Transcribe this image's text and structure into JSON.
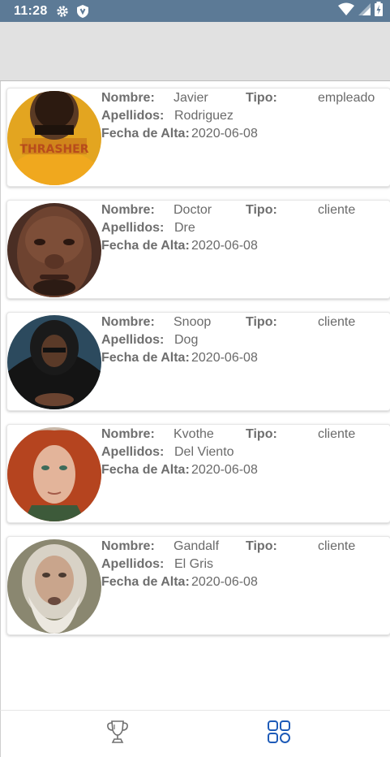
{
  "status_bar": {
    "time": "11:28",
    "icons_left": [
      "gear-icon",
      "shield-icon"
    ],
    "icons_right": [
      "wifi-icon",
      "signal-icon",
      "battery-icon"
    ]
  },
  "labels": {
    "nombre": "Nombre:",
    "tipo": "Tipo:",
    "apellidos": "Apellidos:",
    "fecha": "Fecha de Alta:"
  },
  "users": [
    {
      "nombre": "Javier",
      "apellidos": "Rodriguez",
      "tipo": "empleado",
      "fecha": "2020-06-08",
      "avatar": "avatar-photo"
    },
    {
      "nombre": "Doctor",
      "apellidos": "Dre",
      "tipo": "cliente",
      "fecha": "2020-06-08",
      "avatar": "avatar-photo"
    },
    {
      "nombre": "Snoop",
      "apellidos": "Dog",
      "tipo": "cliente",
      "fecha": "2020-06-08",
      "avatar": "avatar-photo"
    },
    {
      "nombre": "Kvothe",
      "apellidos": "Del Viento",
      "tipo": "cliente",
      "fecha": "2020-06-08",
      "avatar": "avatar-photo"
    },
    {
      "nombre": "Gandalf",
      "apellidos": "El Gris",
      "tipo": "cliente",
      "fecha": "2020-06-08",
      "avatar": "avatar-photo"
    }
  ],
  "bottom_nav": {
    "items": [
      {
        "icon": "trophy-icon",
        "active": false
      },
      {
        "icon": "grid-icon",
        "active": true
      }
    ],
    "active_color": "#1e5bb8",
    "inactive_color": "#707070"
  }
}
